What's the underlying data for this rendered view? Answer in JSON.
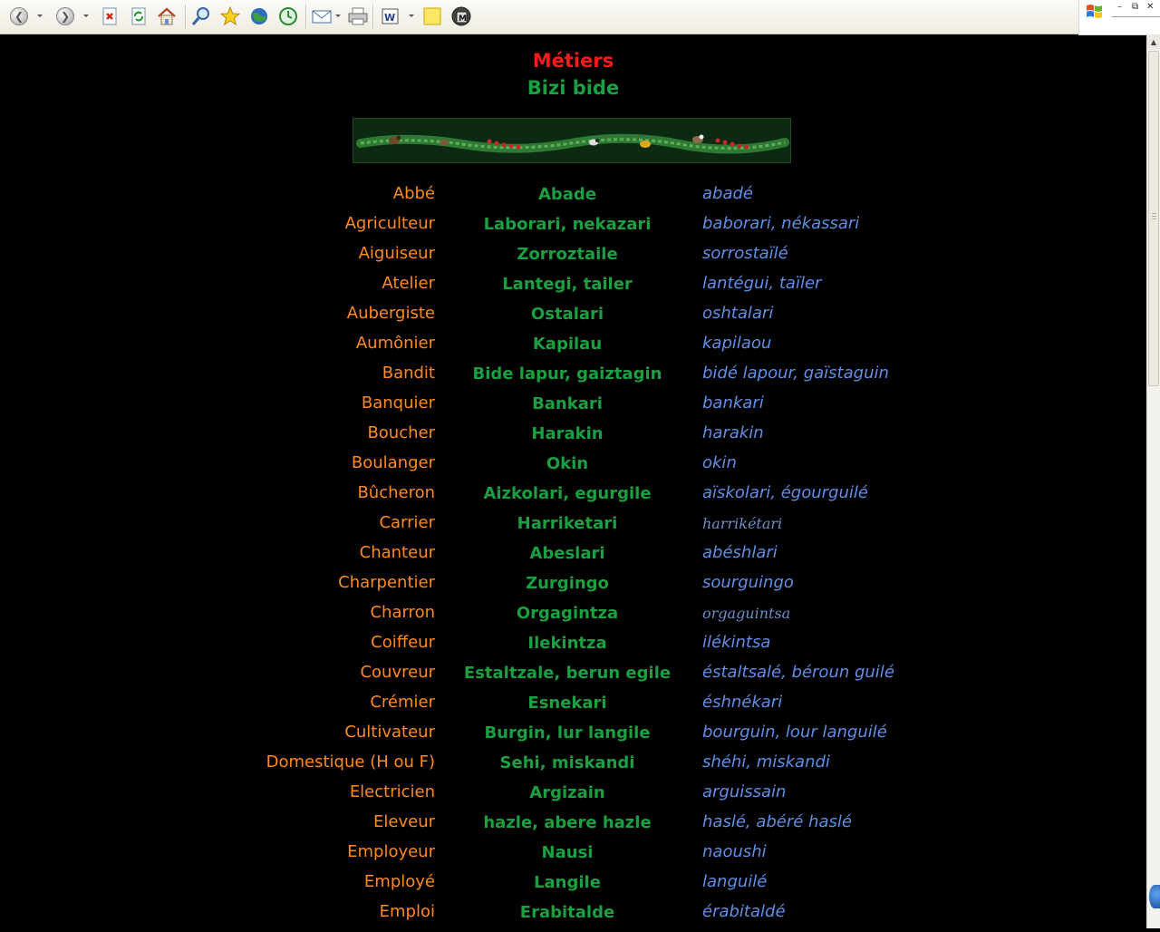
{
  "page": {
    "title": "Métiers",
    "subtitle": "Bizi bide",
    "colors": {
      "background": "#000000",
      "title": "#ff1a1a",
      "subtitle": "#1aa040",
      "french": "#ff8a1c",
      "basque": "#1aa040",
      "pronunciation": "#5f8fe6"
    }
  },
  "toolbar": {
    "icons": [
      "back-icon",
      "forward-icon",
      "stop-icon",
      "refresh-icon",
      "home-icon",
      "search-icon",
      "favorites-icon",
      "media-icon",
      "history-icon",
      "mail-icon",
      "print-icon",
      "edit-icon",
      "discuss-icon",
      "messenger-icon"
    ]
  },
  "rows": [
    {
      "fr": "Abbé",
      "eu": "Abade",
      "pr": "abadé"
    },
    {
      "fr": "Agriculteur",
      "eu": "Laborari, nekazari",
      "pr": "baborari, nékassari"
    },
    {
      "fr": "Aiguiseur",
      "eu": "Zorroztaile",
      "pr": "sorrostaïlé"
    },
    {
      "fr": "Atelier",
      "eu": "Lantegi, tailer",
      "pr": "lantégui, taïler"
    },
    {
      "fr": "Aubergiste",
      "eu": "Ostalari",
      "pr": "oshtalari"
    },
    {
      "fr": "Aumônier",
      "eu": "Kapilau",
      "pr": "kapilaou"
    },
    {
      "fr": "Bandit",
      "eu": "Bide lapur, gaiztagin",
      "pr": "bidé lapour, gaïstaguin"
    },
    {
      "fr": "Banquier",
      "eu": "Bankari",
      "pr": "bankari"
    },
    {
      "fr": "Boucher",
      "eu": "Harakin",
      "pr": "harakin"
    },
    {
      "fr": "Boulanger",
      "eu": "Okin",
      "pr": "okin"
    },
    {
      "fr": "Bûcheron",
      "eu": "Aizkolari, egurgile",
      "pr": "aïskolari, égourguilé"
    },
    {
      "fr": "Carrier",
      "eu": "Harriketari",
      "pr": "harrikétari",
      "serif": true
    },
    {
      "fr": "Chanteur",
      "eu": "Abeslari",
      "pr": "abéshlari"
    },
    {
      "fr": "Charpentier",
      "eu": "Zurgingo",
      "pr": "sourguingo"
    },
    {
      "fr": "Charron",
      "eu": "Orgagintza",
      "pr": "orgaguintsa",
      "serif": true
    },
    {
      "fr": "Coiffeur",
      "eu": "Ilekintza",
      "pr": "ilékintsa"
    },
    {
      "fr": "Couvreur",
      "eu": "Estaltzale, berun egile",
      "pr": "éstaltsalé, béroun guilé"
    },
    {
      "fr": "Crémier",
      "eu": "Esnekari",
      "pr": "éshnékari"
    },
    {
      "fr": "Cultivateur",
      "eu": "Burgin, lur langile",
      "pr": "bourguin, lour languilé"
    },
    {
      "fr": "Domestique (H ou F)",
      "eu": "Sehi, miskandi",
      "pr": "shéhi, miskandi"
    },
    {
      "fr": "Electricien",
      "eu": "Argizain",
      "pr": "arguissain"
    },
    {
      "fr": "Eleveur",
      "eu": "hazle, abere hazle",
      "pr": "haslé, abéré haslé"
    },
    {
      "fr": "Employeur",
      "eu": "Nausi",
      "pr": "naoushi"
    },
    {
      "fr": "Employé",
      "eu": "Langile",
      "pr": "languilé"
    },
    {
      "fr": "Emploi",
      "eu": "Erabitalde",
      "pr": "érabitaldé"
    }
  ]
}
